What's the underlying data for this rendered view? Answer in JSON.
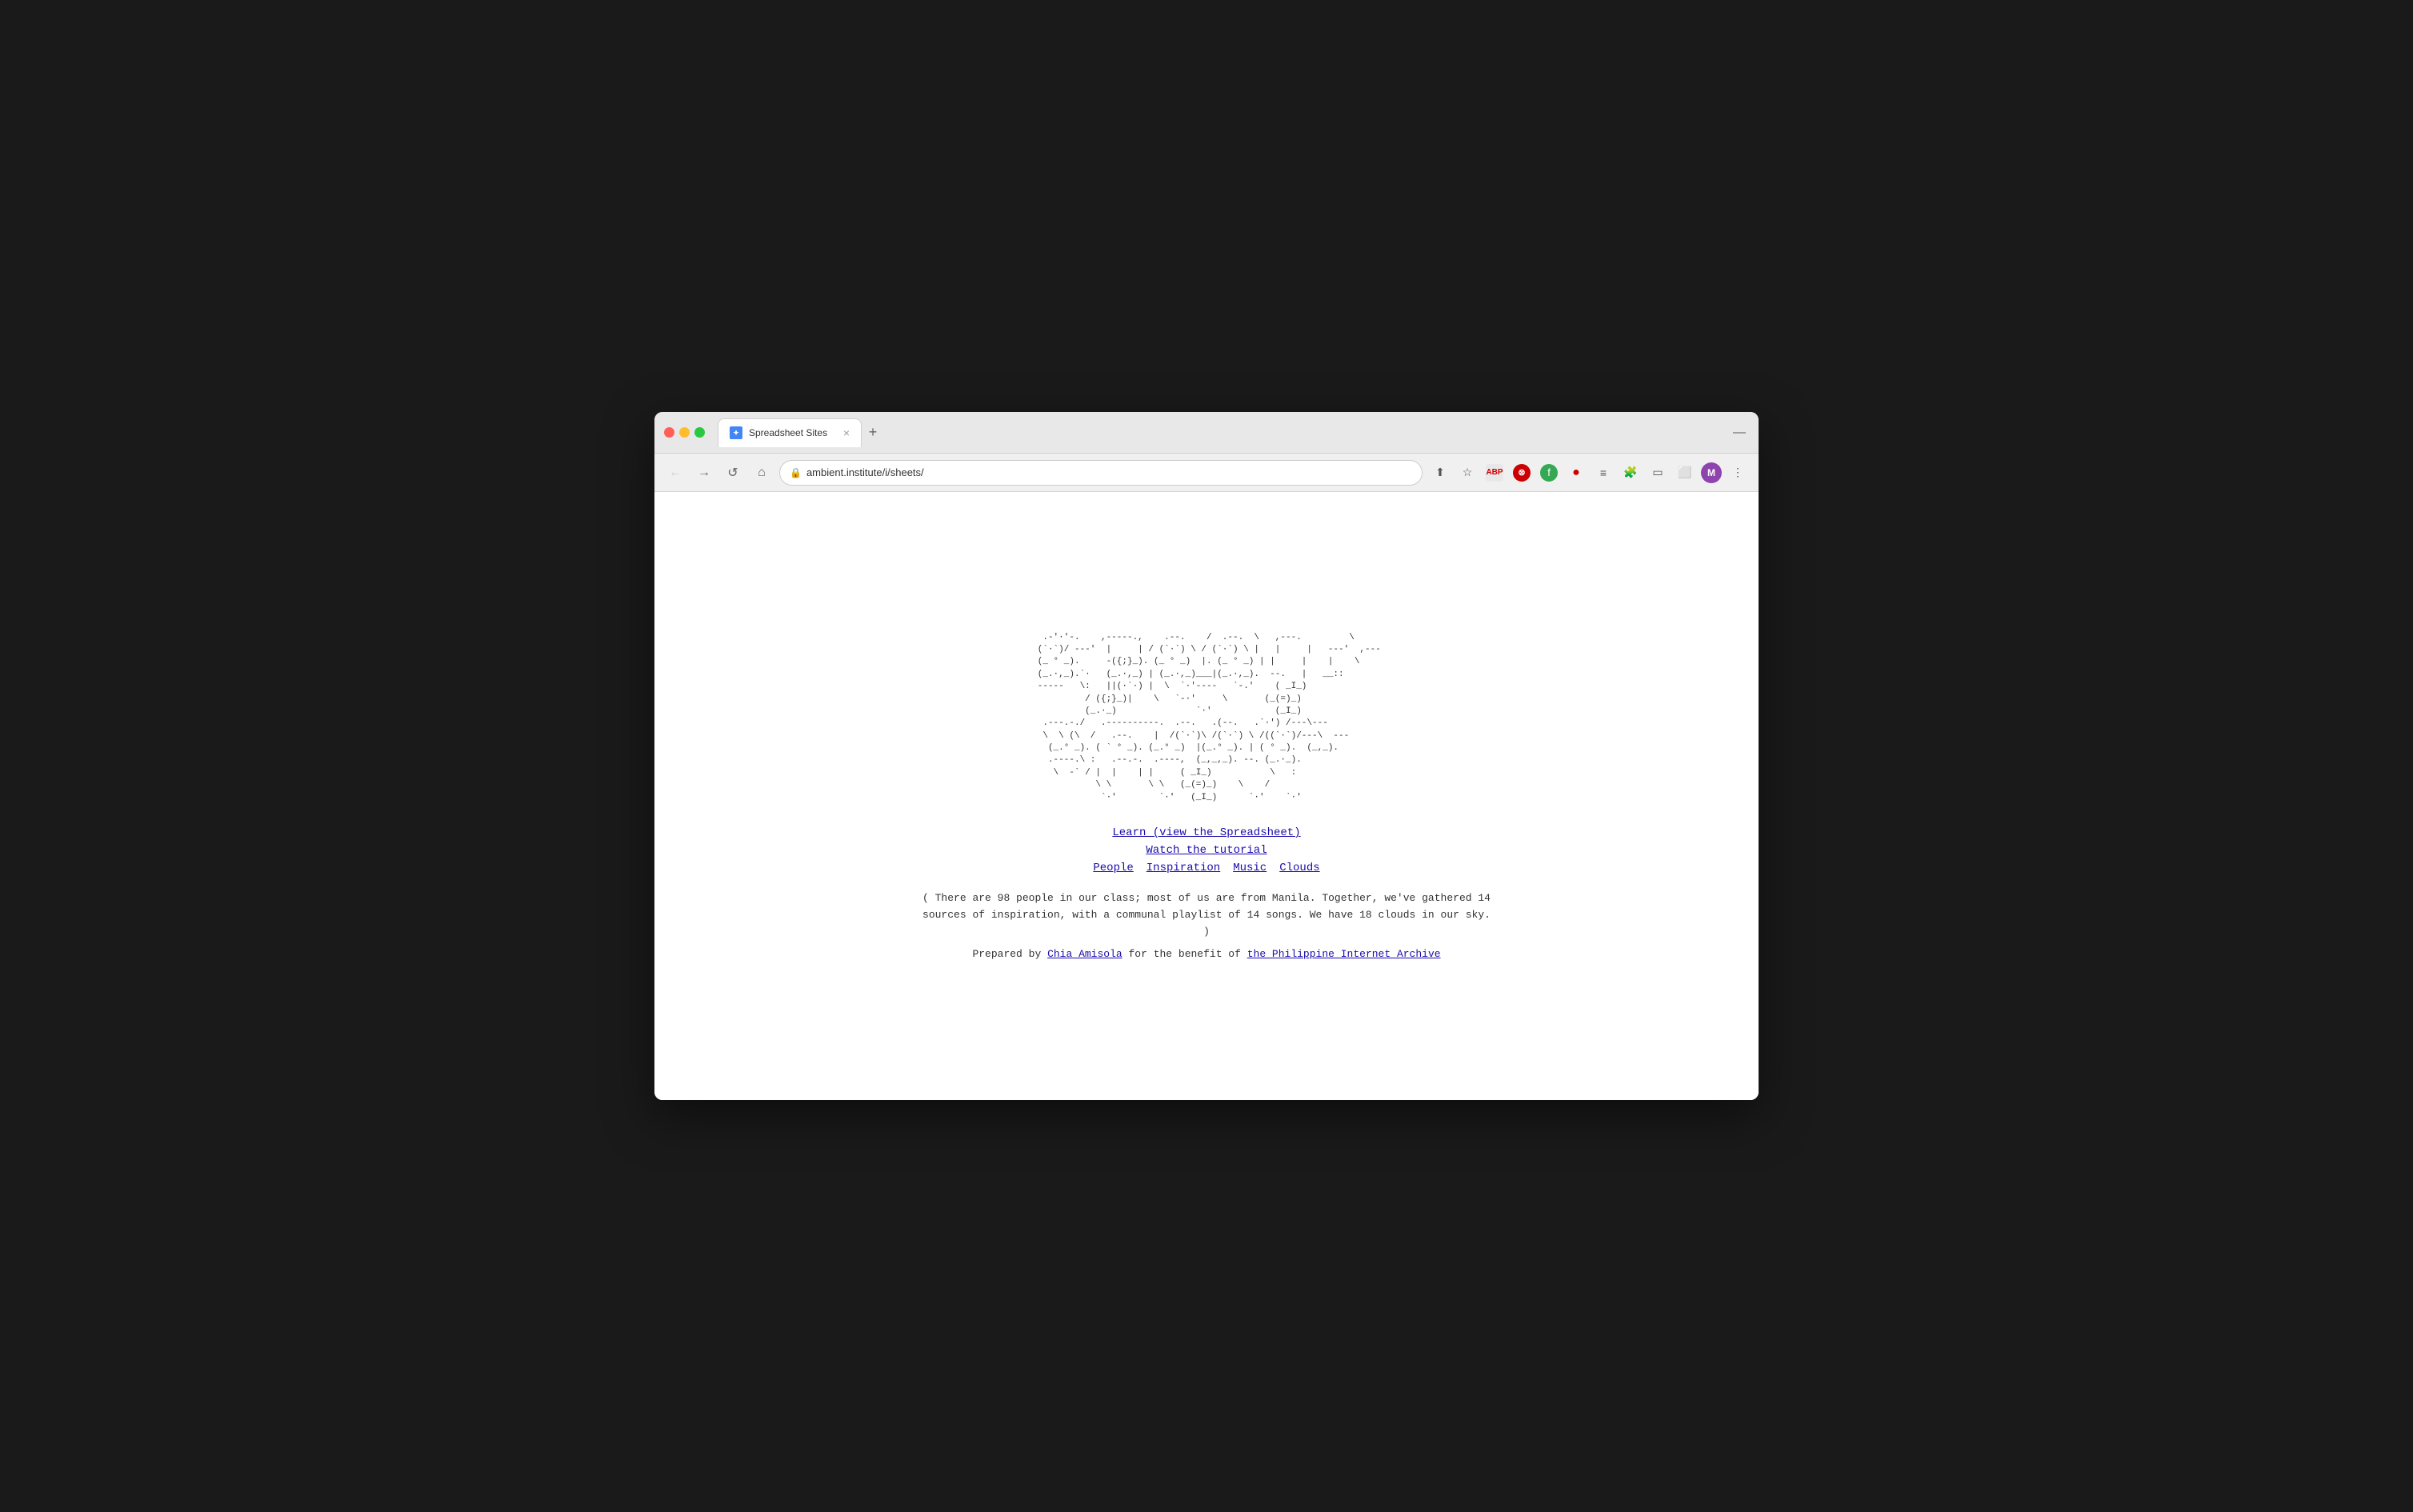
{
  "browser": {
    "tab_title": "Spreadsheet Sites",
    "tab_favicon": "S",
    "url": "ambient.institute/i/sheets/",
    "new_tab_label": "+",
    "window_minimize": "—"
  },
  "toolbar": {
    "back_arrow": "←",
    "forward_arrow": "→",
    "reload": "↺",
    "home": "⌂",
    "lock_icon": "🔒",
    "share_icon": "⬆",
    "bookmark_icon": "☆",
    "extensions_icon": "⚡",
    "reading_list": "≡",
    "extension_pin": "📌",
    "cast_icon": "📺",
    "sidebar_icon": "▣",
    "menu_icon": "⋮",
    "avatar_letter": "M"
  },
  "page": {
    "ascii_art": "  .-'·'-.    ,-----.,   .--.   /  .--.  \\  ,---.     \\   \n (`·`)/ ---'  |     | / (  `·`) \\/ (  `·`) \\ |     |   ---.   ---\n (_ ° _).     -({;}_). (_ ° _)  |. (_ ° _)  ||     |    |    \\\n (_.·,_).`·   (_.·,_) | (_.·,_)___| (_.·,_).--.    |   __::\n -----   \\:   ||(·`·) | \\  `·-'----.  `-.'    (  _I_)\n         / ({;}_)|     \\  `-·'   \\     (_(=)_)\n         (_.·_)              `·'            (_I_)\n .---.-./  .----------.  .--.  .(--.  .`·')/---\\---\n \\  \\ (\\  /  .--.     |  /(`·`)\\  /(  `·)\\  /((`·`)/---\\  ---\n  (_.° _). ( ` ° _). (_.° _) |(_.° _). |  (  ° _).  (_,_).\n  .----.\\  :  .--.-.  .----,  (_,_,_).--.  (_.·_).\n   \\  -`  / | |    | |    (  _I_)           \\   :\n           \\ \\       \\ \\   (_(=)_)    \\    /\n            `·'        `·'   (_I_)      `·'    `·",
    "learn_link": "Learn (view the Spreadsheet)",
    "tutorial_link": "Watch the tutorial",
    "nav_links": [
      {
        "label": "People",
        "href": "#people"
      },
      {
        "label": "Inspiration",
        "href": "#inspiration"
      },
      {
        "label": "Music",
        "href": "#music"
      },
      {
        "label": "Clouds",
        "href": "#clouds"
      }
    ],
    "description": "( There are 98 people in our class; most of us are from Manila. Together, we've gathered 14 sources of inspiration, with a communal playlist of 14 songs. We have 18 clouds in our sky. )",
    "prepared_prefix": "Prepared by ",
    "prepared_name": "Chia Amisola",
    "prepared_middle": " for the benefit of ",
    "prepared_org": "the Philippine Internet Archive"
  }
}
